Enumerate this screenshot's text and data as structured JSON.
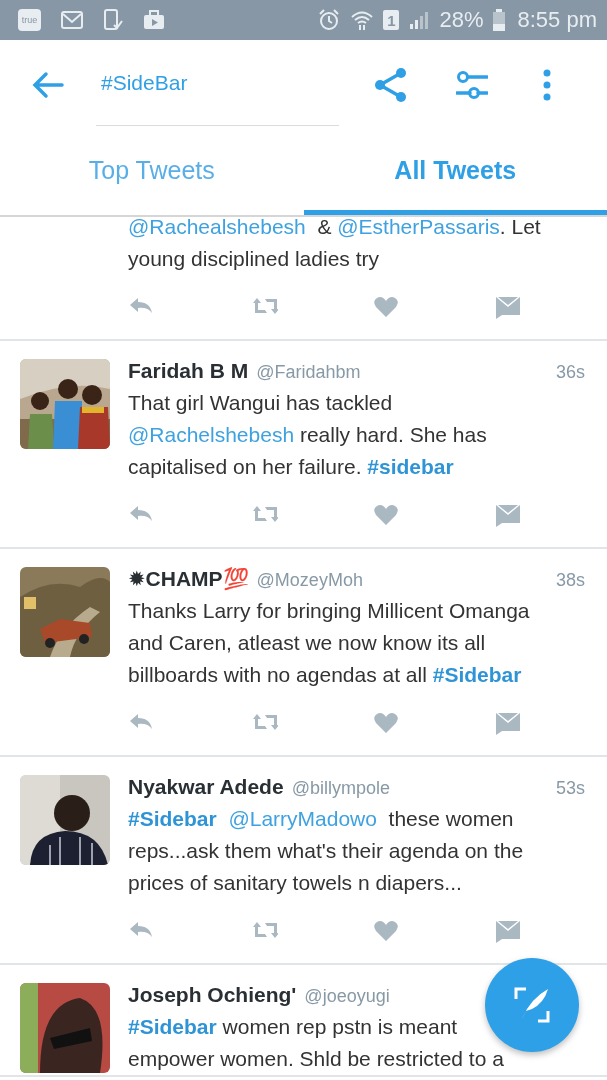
{
  "status_bar": {
    "left_badge": "true",
    "sim_slot": "1",
    "battery": "28%",
    "time": "8:55 pm"
  },
  "toolbar": {
    "query": "#SideBar"
  },
  "tabs": [
    {
      "label": "Top Tweets",
      "selected": false
    },
    {
      "label": "All Tweets",
      "selected": true
    }
  ],
  "tweets": [
    {
      "actions": true,
      "lines": [
        [
          {
            "kind": "mention",
            "text": "@Rachealshebesh"
          },
          {
            "kind": "text",
            "text": "  & "
          },
          {
            "kind": "mention",
            "text": "@EstherPassaris"
          },
          {
            "kind": "text",
            "text": ". Let"
          }
        ],
        [
          {
            "kind": "text",
            "text": "young disciplined ladies try"
          }
        ]
      ]
    },
    {
      "name": "Faridah B M",
      "handle": "@Faridahbm",
      "time": "36s",
      "avatar": {
        "kind": "picture"
      },
      "actions": true,
      "lines": [
        [
          {
            "kind": "text",
            "text": "That girl Wangui has tackled"
          }
        ],
        [
          {
            "kind": "mention",
            "text": "@Rachelshebesh"
          },
          {
            "kind": "text",
            "text": " really hard. She has"
          }
        ],
        [
          {
            "kind": "text",
            "text": "capitalised on her failure. "
          },
          {
            "kind": "hashtag",
            "text": "#sidebar"
          }
        ]
      ]
    },
    {
      "name": "✹CHAMP💯",
      "handle": "@MozeyMoh",
      "time": "38s",
      "avatar": {
        "kind": "picture"
      },
      "actions": true,
      "lines": [
        [
          {
            "kind": "text",
            "text": "Thanks Larry for bringing Millicent Omanga"
          }
        ],
        [
          {
            "kind": "text",
            "text": "and Caren, atleast we now know its all"
          }
        ],
        [
          {
            "kind": "text",
            "text": "billboards with no agendas at all "
          },
          {
            "kind": "hashtag",
            "text": "#Sidebar"
          }
        ]
      ]
    },
    {
      "name": "Nyakwar Adede",
      "handle": "@billympole",
      "time": "53s",
      "avatar": {
        "kind": "picture"
      },
      "actions": true,
      "lines": [
        [
          {
            "kind": "hashtag",
            "text": "#Sidebar "
          },
          {
            "kind": "mention",
            "text": " @LarryMadowo"
          },
          {
            "kind": "text",
            "text": "  these women"
          }
        ],
        [
          {
            "kind": "text",
            "text": "reps...ask them what's their agenda on the"
          }
        ],
        [
          {
            "kind": "text",
            "text": "prices of sanitary towels n diapers..."
          }
        ]
      ]
    },
    {
      "name": "Joseph Ochieng'",
      "handle": "@joeoyugi",
      "avatar": {
        "kind": "picture"
      },
      "actions": false,
      "lines": [
        [
          {
            "kind": "hashtag",
            "text": "#Sidebar"
          },
          {
            "kind": "text",
            "text": " women rep pstn is meant"
          }
        ],
        [
          {
            "kind": "text",
            "text": "empower women. Shld be restricted to a"
          }
        ]
      ]
    }
  ]
}
